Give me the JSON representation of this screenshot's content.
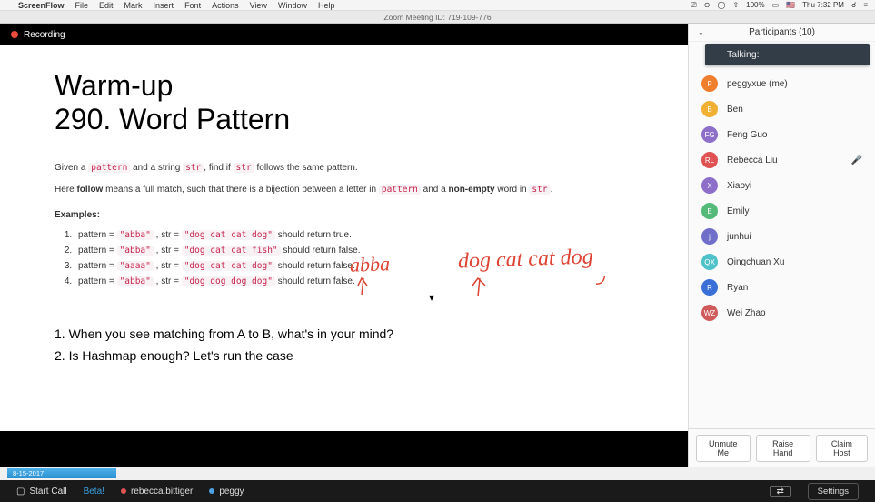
{
  "menubar": {
    "app": "ScreenFlow",
    "items": [
      "File",
      "Edit",
      "Mark",
      "Insert",
      "Font",
      "Actions",
      "View",
      "Window",
      "Help"
    ],
    "right": {
      "battery": "100%",
      "clock": "Thu 7:32 PM"
    }
  },
  "titlebar": "Zoom Meeting ID: 719-109-776",
  "recording_label": "Recording",
  "slide": {
    "title_line1": "Warm-up",
    "title_line2": "290. Word Pattern",
    "p1_parts": [
      "Given a ",
      "pattern",
      " and a string ",
      "str",
      ", find if ",
      "str",
      " follows the same pattern."
    ],
    "p2_parts": [
      "Here ",
      "follow",
      " means a full match, such that there is a bijection between a letter in ",
      "pattern",
      " and a ",
      "non-empty",
      " word in ",
      "str",
      "."
    ],
    "examples_label": "Examples:",
    "examples": [
      {
        "pattern": "\"abba\"",
        "str": "\"dog cat cat dog\"",
        "result": "should return true."
      },
      {
        "pattern": "\"abba\"",
        "str": "\"dog cat cat fish\"",
        "result": "should return false."
      },
      {
        "pattern": "\"aaaa\"",
        "str": "\"dog cat cat dog\"",
        "result": "should return false."
      },
      {
        "pattern": "\"abba\"",
        "str": "\"dog dog dog dog\"",
        "result": "should return false."
      }
    ],
    "annot_left": "abba",
    "annot_right": "dog cat cat dog",
    "followups": [
      "1. When you see matching from A to B, what's in your mind?",
      "2. Is Hashmap enough? Let's run the case"
    ]
  },
  "participants": {
    "header": "Participants (10)",
    "talking_label": "Talking:",
    "list": [
      {
        "initial": "P",
        "name": "peggyxue (me)",
        "color": "#ef7e2e"
      },
      {
        "initial": "B",
        "name": "Ben",
        "color": "#f0b033"
      },
      {
        "initial": "FG",
        "name": "Feng Guo",
        "color": "#8d6fca"
      },
      {
        "initial": "RL",
        "name": "Rebecca Liu",
        "color": "#e05252",
        "mic": true
      },
      {
        "initial": "X",
        "name": "Xiaoyi",
        "color": "#8d6fca"
      },
      {
        "initial": "E",
        "name": "Emily",
        "color": "#55b97a"
      },
      {
        "initial": "j",
        "name": "junhui",
        "color": "#6f6fca"
      },
      {
        "initial": "QX",
        "name": "Qingchuan Xu",
        "color": "#4fc1c9"
      },
      {
        "initial": "R",
        "name": "Ryan",
        "color": "#3a6fd8"
      },
      {
        "initial": "WZ",
        "name": "Wei Zhao",
        "color": "#d05a5a"
      }
    ],
    "actions": {
      "unmute": "Unmute Me",
      "raise": "Raise Hand",
      "claim": "Claim Host"
    }
  },
  "date_ribbon": "8-15-2017",
  "zoombar": {
    "start_call": "Start Call",
    "beta": "Beta!",
    "user1": {
      "name": "rebecca.bittiger",
      "color": "#e05252"
    },
    "user2": {
      "name": "peggy",
      "color": "#4ea1e0"
    },
    "settings": "Settings"
  }
}
